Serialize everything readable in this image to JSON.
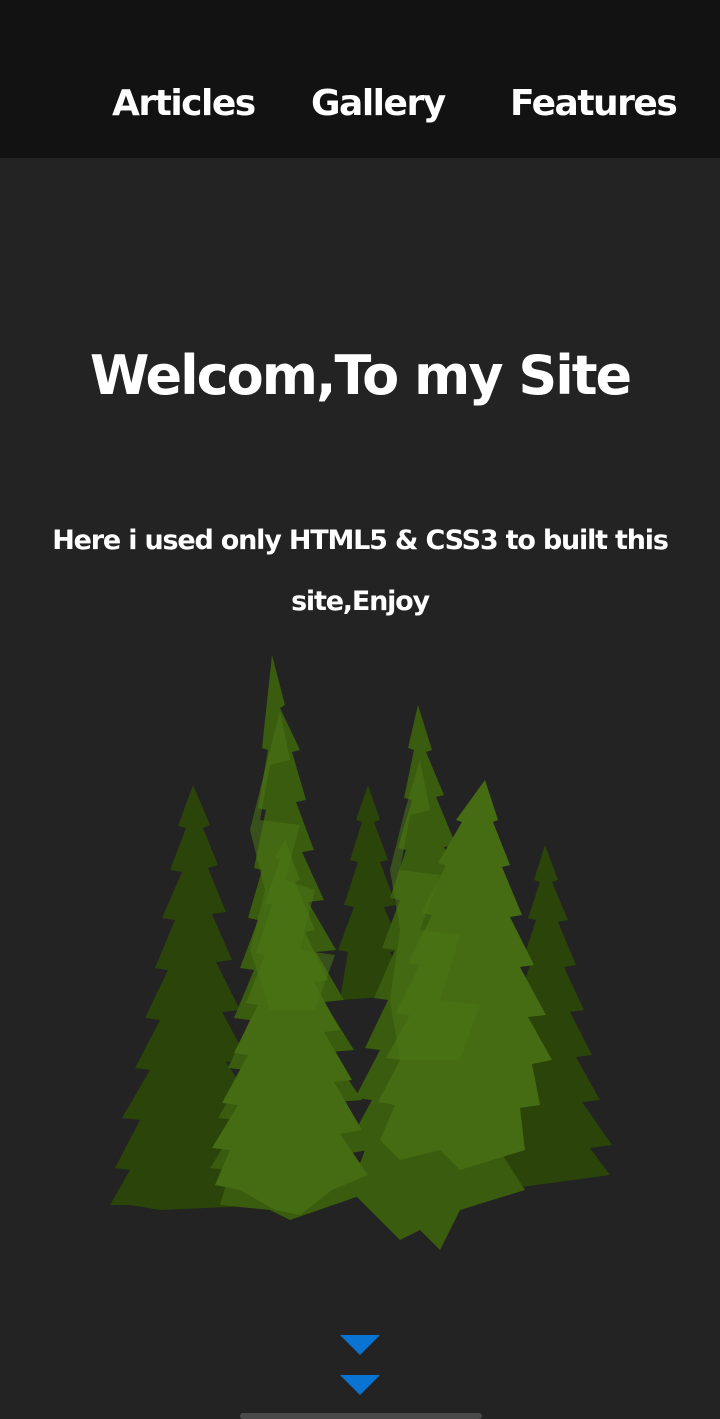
{
  "nav": {
    "items": [
      {
        "label": "Articles"
      },
      {
        "label": "Gallery"
      },
      {
        "label": "Features"
      }
    ]
  },
  "hero": {
    "title": "Welcom,To my Site",
    "text": "Here i used only HTML5 & CSS3 to built this site,Enjoy"
  },
  "illustration": {
    "name": "pine-forest"
  },
  "scroll": {
    "icon": "chevron-down-icon",
    "color": "#0a74d3"
  },
  "colors": {
    "nav_bg": "#121212",
    "page_bg": "#232323",
    "text": "#ffffff",
    "tree_light": "#3f6410",
    "tree_dark": "#2a4409"
  }
}
